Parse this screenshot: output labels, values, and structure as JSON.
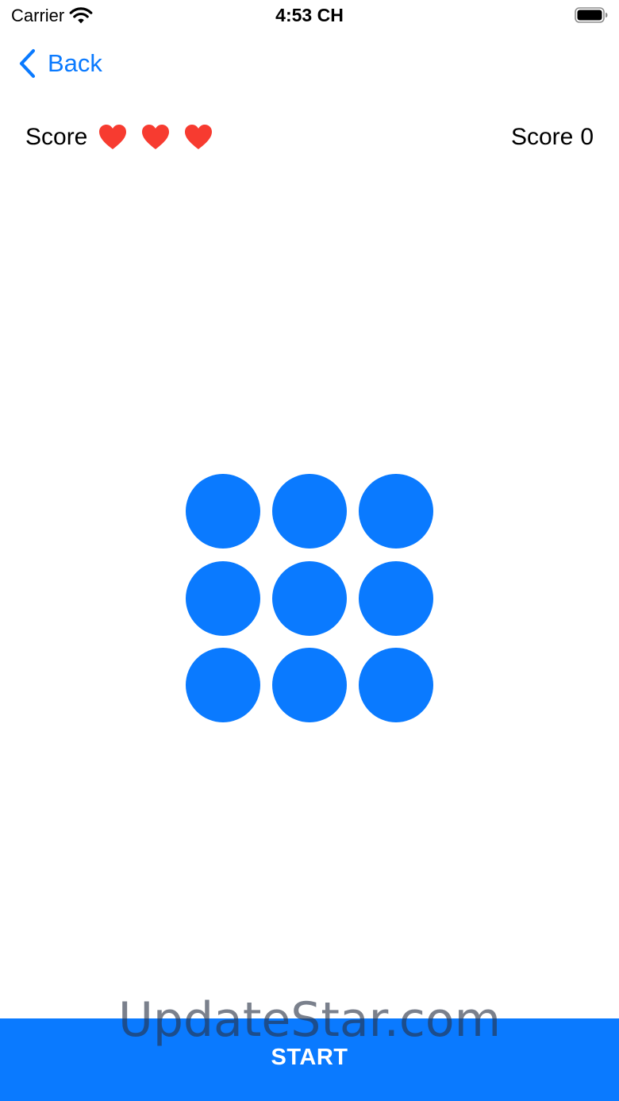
{
  "status_bar": {
    "carrier": "Carrier",
    "time": "4:53 CH",
    "wifi_icon": "wifi-icon",
    "battery_icon": "battery-icon"
  },
  "nav": {
    "back_label": "Back",
    "back_icon": "chevron-left-icon"
  },
  "score_bar": {
    "lives_label": "Score",
    "lives_count": 3,
    "lives_icon": "heart-icon",
    "score_label": "Score",
    "score_value": "0"
  },
  "game_grid": {
    "rows": 3,
    "columns": 3,
    "dot_color": "#0a7aff"
  },
  "start_button": {
    "label": "START",
    "color": "#0a7aff"
  },
  "watermark": {
    "text": "UpdateStar.com"
  },
  "colors": {
    "accent": "#0a7aff",
    "heart": "#f73b30"
  }
}
